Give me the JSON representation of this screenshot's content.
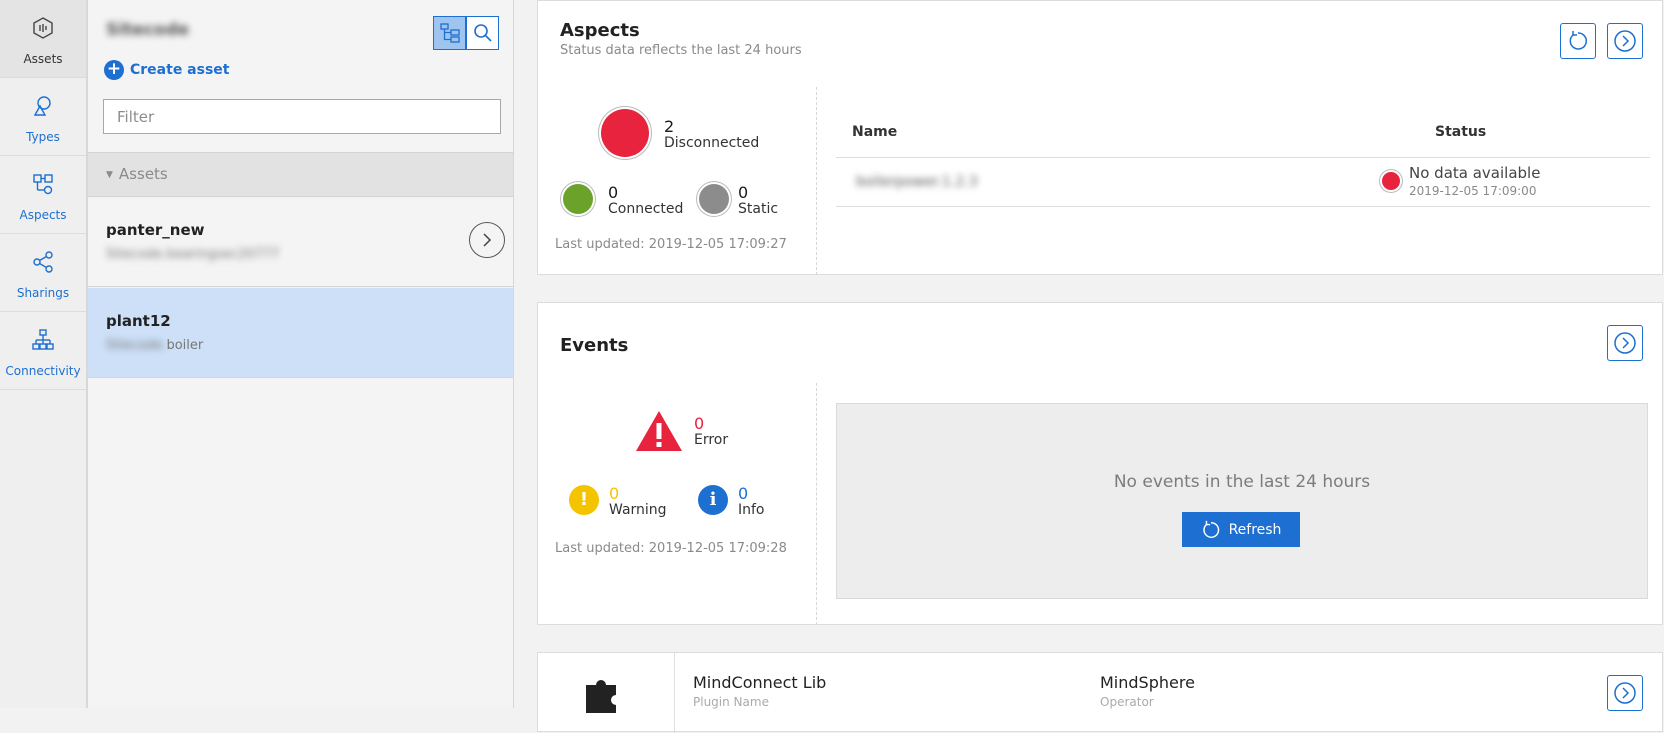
{
  "rail": {
    "items": [
      {
        "label": "Assets",
        "icon": "assets-icon",
        "active": true
      },
      {
        "label": "Types",
        "icon": "types-icon"
      },
      {
        "label": "Aspects",
        "icon": "aspects-icon"
      },
      {
        "label": "Sharings",
        "icon": "sharings-icon"
      },
      {
        "label": "Connectivity",
        "icon": "connectivity-icon"
      }
    ]
  },
  "list": {
    "title": "Sitecode",
    "create_label": "Create asset",
    "filter_placeholder": "Filter",
    "group_label": "Assets",
    "assets": [
      {
        "name": "panter_new",
        "subtitle": "Sitecode.bearingsec20777"
      },
      {
        "name": "plant12",
        "subtitle_blur": "Sitecode.",
        "subtitle": "boiler"
      }
    ]
  },
  "aspects": {
    "title": "Aspects",
    "subtitle": "Status data reflects the last 24 hours",
    "disconnected": {
      "count": "2",
      "label": "Disconnected"
    },
    "connected": {
      "count": "0",
      "label": "Connected"
    },
    "static": {
      "count": "0",
      "label": "Static"
    },
    "updated": "Last updated: 2019-12-05 17:09:27",
    "table": {
      "col_name": "Name",
      "col_status": "Status",
      "rows": [
        {
          "name": "boilerpower.1.2.3",
          "status": "No data available",
          "time": "2019-12-05 17:09:00"
        }
      ]
    }
  },
  "events": {
    "title": "Events",
    "error": {
      "count": "0",
      "label": "Error"
    },
    "warning": {
      "count": "0",
      "label": "Warning"
    },
    "info": {
      "count": "0",
      "label": "Info"
    },
    "updated": "Last updated: 2019-12-05 17:09:28",
    "empty_msg": "No events in the last 24 hours",
    "refresh_label": "Refresh"
  },
  "plugin": {
    "name": "MindConnect Lib",
    "name_caption": "Plugin Name",
    "operator": "MindSphere",
    "operator_caption": "Operator"
  },
  "colors": {
    "accent": "#1d6fd1",
    "disconnected": "#e8233e",
    "connected": "#6aa22a",
    "static": "#8c8c8c",
    "warning": "#f5c400",
    "error": "#e8233e"
  }
}
